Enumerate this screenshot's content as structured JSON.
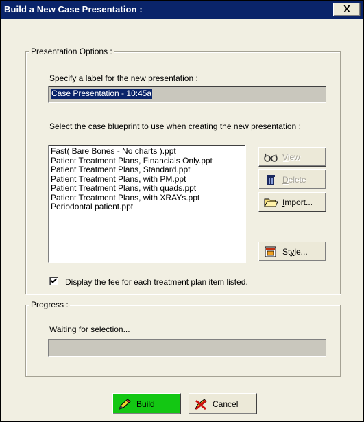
{
  "window": {
    "title": "Build a New Case Presentation :",
    "close_label": "X"
  },
  "options": {
    "legend": "Presentation Options :",
    "label_prompt": "Specify a label for the new presentation  :",
    "label_value": "Case Presentation - 10:45a",
    "blueprint_prompt": "Select the case blueprint to use when creating the new presentation :",
    "blueprints": [
      "Fast( Bare Bones - No charts ).ppt",
      "Patient Treatment Plans, Financials Only.ppt",
      "Patient Treatment Plans, Standard.ppt",
      "Patient Treatment Plans, with PM.ppt",
      "Patient Treatment Plans, with quads.ppt",
      "Patient Treatment Plans, with XRAYs.ppt",
      "Periodontal patient.ppt"
    ],
    "buttons": {
      "view": {
        "first": "V",
        "rest": "iew",
        "icon": "glasses-icon"
      },
      "delete": {
        "first": "D",
        "rest": "elete",
        "icon": "trash-icon"
      },
      "import": {
        "first": "I",
        "rest": "mport...",
        "icon": "folder-icon"
      },
      "style": {
        "pre": "St",
        "ul": "y",
        "post": "le...",
        "icon": "style-icon"
      }
    },
    "show_fee_checked": true,
    "show_fee_label": "Display the fee for each treatment plan item listed."
  },
  "progress": {
    "legend": "Progress :",
    "status": "Waiting for selection...",
    "value": 0
  },
  "footer": {
    "build": {
      "first": "B",
      "rest": "uild",
      "icon": "pencil-icon",
      "color": "#13c713"
    },
    "cancel": {
      "first": "C",
      "rest": "ancel",
      "icon": "cancel-icon"
    }
  },
  "colors": {
    "titlebar": "#0a246a",
    "dialog_bg": "#f1efe2",
    "selection": "#0a246a"
  }
}
